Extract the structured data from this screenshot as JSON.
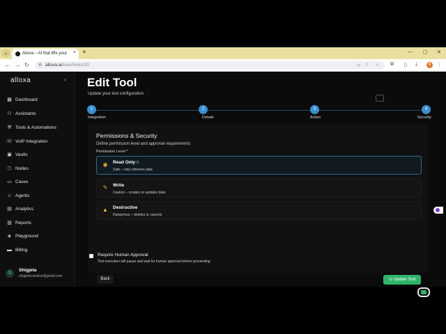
{
  "browser": {
    "tab_title": "Alloxa – AI that lifts your whole",
    "tab_close": "×",
    "new_tab": "+",
    "url_domain": "alloxa.ai",
    "url_path": "/user/tools/20",
    "profile_initial": "N"
  },
  "sidebar": {
    "logo": "alloxa",
    "collapse": "‹",
    "items": [
      {
        "label": "Dashboard",
        "icon": "grid-icon",
        "glyph": "▦"
      },
      {
        "label": "Assistants",
        "icon": "users-icon",
        "glyph": "⚇"
      },
      {
        "label": "Tools & Automations",
        "icon": "wrench-icon",
        "glyph": "⚒"
      },
      {
        "label": "VoIP Integration",
        "icon": "phone-icon",
        "glyph": "☏"
      },
      {
        "label": "Vaults",
        "icon": "vault-icon",
        "glyph": "▣"
      },
      {
        "label": "Nodes",
        "icon": "nodes-icon",
        "glyph": "⬡"
      },
      {
        "label": "Cases",
        "icon": "folder-icon",
        "glyph": "▭"
      },
      {
        "label": "Agents",
        "icon": "agent-icon",
        "glyph": "☺"
      },
      {
        "label": "Analytics",
        "icon": "chart-icon",
        "glyph": "▤"
      },
      {
        "label": "Reports",
        "icon": "report-icon",
        "glyph": "▥"
      },
      {
        "label": "Playground",
        "icon": "play-icon",
        "glyph": "◈"
      },
      {
        "label": "Billing",
        "icon": "card-icon",
        "glyph": "▬"
      }
    ],
    "user": {
      "initial": "S",
      "name": "Shigjeta",
      "email": "shigjetacreative@gmail.com"
    }
  },
  "page": {
    "title": "Edit Tool",
    "subtitle": "Update your tool configuration",
    "steps": [
      {
        "num": "1",
        "label": "Integration"
      },
      {
        "num": "2",
        "label": "Details"
      },
      {
        "num": "3",
        "label": "Action"
      },
      {
        "num": "4",
        "label": "Security"
      }
    ]
  },
  "form": {
    "section_title": "Permissions & Security",
    "section_sub": "Define permission level and approval requirements",
    "field_label": "Permission Level *",
    "options": [
      {
        "title": "Read Only",
        "desc": "Safe – only retrieves data",
        "icon": "eye-icon",
        "glyph": "◉",
        "color": "#f0b13c",
        "selected": true
      },
      {
        "title": "Write",
        "desc": "Caution – creates or updates data",
        "icon": "pencil-icon",
        "glyph": "✎",
        "color": "#f0b13c",
        "selected": false
      },
      {
        "title": "Destructive",
        "desc": "Dangerous – deletes or cancels",
        "icon": "warning-icon",
        "glyph": "▲",
        "color": "#f2c230",
        "selected": false
      }
    ],
    "approval_title": "Require Human Approval",
    "approval_desc": "Tool execution will pause and wait for human approval before proceeding",
    "back_label": "Back",
    "update_label": "⊙ Update Tool"
  }
}
